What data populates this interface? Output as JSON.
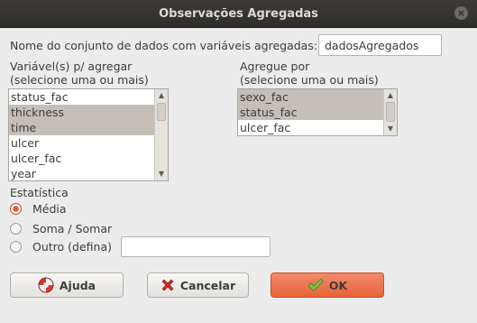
{
  "window": {
    "title": "Observações Agregadas",
    "close_glyph": "×"
  },
  "dataset": {
    "label": "Nome do conjunto de dados com variáveis agregadas:",
    "value": "dadosAgregados"
  },
  "variables": {
    "label_line1": "Variável(s) p/ agregar",
    "label_line2": "(selecione uma ou mais)",
    "items": [
      {
        "label": "status_fac",
        "selected": false
      },
      {
        "label": "thickness",
        "selected": true
      },
      {
        "label": "time",
        "selected": true
      },
      {
        "label": "ulcer",
        "selected": false
      },
      {
        "label": "ulcer_fac",
        "selected": false
      },
      {
        "label": "year",
        "selected": false
      }
    ]
  },
  "group_by": {
    "label_line1": "Agregue por",
    "label_line2": "(selecione uma ou mais)",
    "items": [
      {
        "label": "sexo_fac",
        "selected": true
      },
      {
        "label": "status_fac",
        "selected": true
      },
      {
        "label": "ulcer_fac",
        "selected": false
      }
    ]
  },
  "statistic": {
    "heading": "Estatística",
    "options": [
      {
        "label": "Média",
        "checked": true
      },
      {
        "label": "Soma / Somar",
        "checked": false
      },
      {
        "label": "Outro (defina)",
        "checked": false
      }
    ],
    "other_value": ""
  },
  "buttons": {
    "help": "Ajuda",
    "cancel": "Cancelar",
    "ok": "OK"
  },
  "colors": {
    "accent": "#e6643b",
    "selection": "#c7bfb6",
    "titlebar": "#3c3b37"
  }
}
